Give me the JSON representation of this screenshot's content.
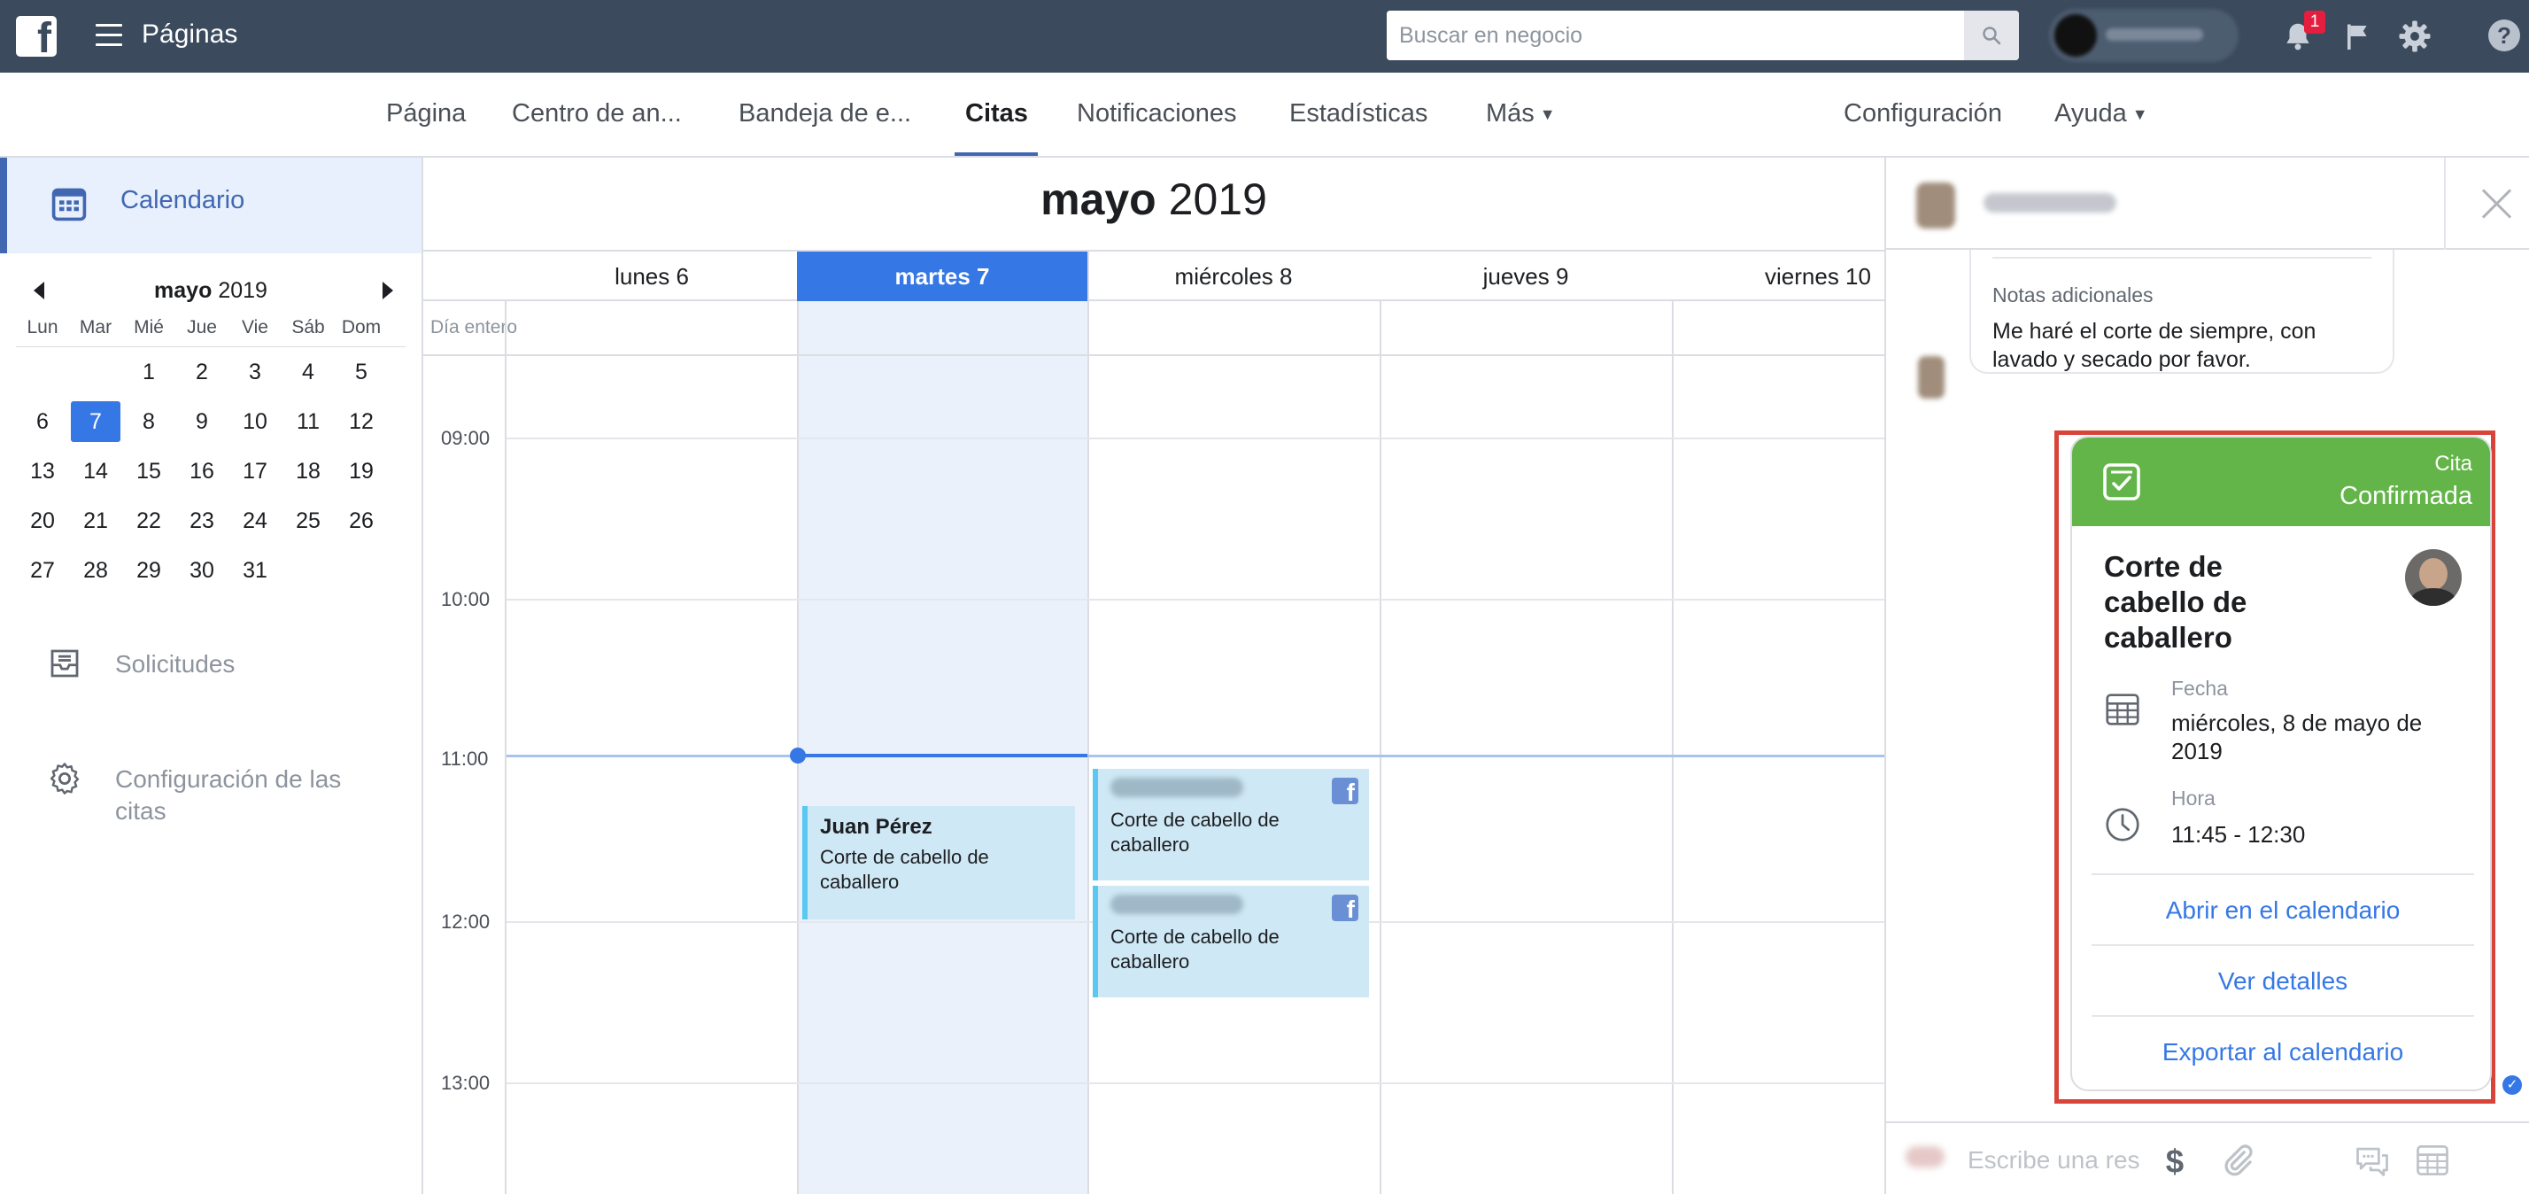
{
  "topbar": {
    "app_title": "Páginas",
    "search_placeholder": "Buscar en negocio",
    "notification_count": "1",
    "help_label": "?"
  },
  "tabs": [
    {
      "label": "Página"
    },
    {
      "label": "Centro de an..."
    },
    {
      "label": "Bandeja de e..."
    },
    {
      "label": "Citas"
    },
    {
      "label": "Notificaciones"
    },
    {
      "label": "Estadísticas"
    },
    {
      "label": "Más"
    },
    {
      "label": "Configuración"
    },
    {
      "label": "Ayuda"
    }
  ],
  "sidebar": {
    "calendar_label": "Calendario",
    "requests_label": "Solicitudes",
    "settings_label": "Configuración de las citas"
  },
  "mini_calendar": {
    "month": "mayo",
    "year": "2019",
    "weekdays": [
      "Lun",
      "Mar",
      "Mié",
      "Jue",
      "Vie",
      "Sáb",
      "Dom"
    ],
    "weeks": [
      [
        "",
        "",
        "1",
        "2",
        "3",
        "4",
        "5"
      ],
      [
        "6",
        "7",
        "8",
        "9",
        "10",
        "11",
        "12"
      ],
      [
        "13",
        "14",
        "15",
        "16",
        "17",
        "18",
        "19"
      ],
      [
        "20",
        "21",
        "22",
        "23",
        "24",
        "25",
        "26"
      ],
      [
        "27",
        "28",
        "29",
        "30",
        "31",
        "",
        ""
      ]
    ],
    "selected_day": "7"
  },
  "calendar": {
    "month": "mayo",
    "year": "2019",
    "days": [
      "lunes 6",
      "martes 7",
      "miércoles 8",
      "jueves 9",
      "viernes 10"
    ],
    "selected_day_index": 1,
    "all_day_label": "Día entero",
    "hours": [
      "09:00",
      "10:00",
      "11:00",
      "12:00",
      "13:00"
    ],
    "events": [
      {
        "name": "Juan Pérez",
        "service": "Corte de cabello de caballero"
      },
      {
        "service": "Corte de cabello de caballero"
      },
      {
        "service": "Corte de cabello de caballero"
      }
    ]
  },
  "messenger": {
    "notes_label": "Notas adicionales",
    "notes_text": "Me haré el corte de siempre, con lavado y secado por favor.",
    "compose_placeholder": "Escribe una res"
  },
  "appointment_card": {
    "kind_label": "Cita",
    "status": "Confirmada",
    "title": "Corte de cabello de caballero",
    "date_label": "Fecha",
    "date_value": "miércoles, 8 de mayo de 2019",
    "time_label": "Hora",
    "time_value": "11:45 - 12:30",
    "actions": [
      "Abrir en el calendario",
      "Ver detalles",
      "Exportar al calendario"
    ]
  },
  "colors": {
    "topbar": "#3b4a5c",
    "accent_blue": "#3578e5",
    "confirmed_green": "#63b54a",
    "highlight_red": "#d9443a",
    "event_bg": "#cfe8f5"
  },
  "icons": [
    "facebook-logo-icon",
    "hamburger-menu-icon",
    "search-icon",
    "bell-icon",
    "flag-icon",
    "gear-icon",
    "help-icon",
    "calendar-grid-icon",
    "inbox-tray-icon",
    "settings-gear-icon",
    "chevron-left-icon",
    "chevron-right-icon",
    "close-icon",
    "checkbox-icon",
    "calendar-icon",
    "clock-icon",
    "dollar-icon",
    "paperclip-icon",
    "chat-bubbles-icon",
    "calendar-compose-icon"
  ]
}
